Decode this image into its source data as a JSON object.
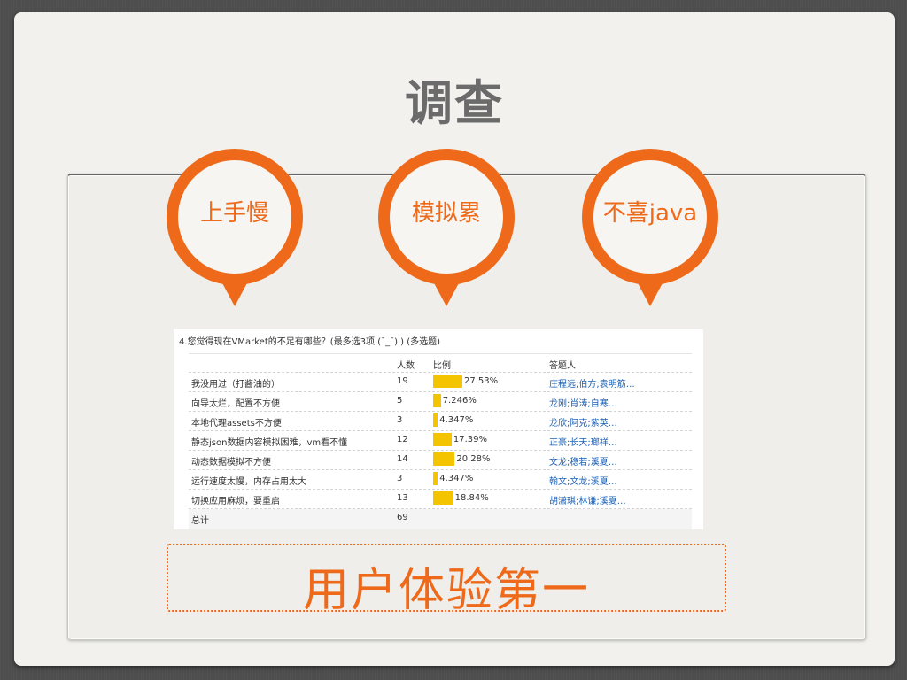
{
  "slide": {
    "title": "调查",
    "bubbles": [
      "上手慢",
      "模拟累",
      "不喜java"
    ],
    "slogan": "用户体验第一"
  },
  "survey": {
    "question": "4.您觉得现在VMarket的不足有哪些？(最多选3项 (¯_¯) ) (多选题)",
    "headers": {
      "option": "",
      "count": "人数",
      "percent": "比例",
      "respondents": "答题人"
    },
    "rows": [
      {
        "option": "我没用过（打酱油的）",
        "count": "19",
        "percent": "27.53%",
        "value": 27.53,
        "respondents": "庄程远;伯方;袁明筋…"
      },
      {
        "option": "向导太烂，配置不方便",
        "count": "5",
        "percent": "7.246%",
        "value": 7.246,
        "respondents": "龙刚;肖涛;自寒…"
      },
      {
        "option": "本地代理assets不方便",
        "count": "3",
        "percent": "4.347%",
        "value": 4.347,
        "respondents": "龙欣;阿克;紫英…"
      },
      {
        "option": "静态json数据内容模拟困难，vm看不懂",
        "count": "12",
        "percent": "17.39%",
        "value": 17.39,
        "respondents": "正豪;长天;瑯祥…"
      },
      {
        "option": "动态数据模拟不方便",
        "count": "14",
        "percent": "20.28%",
        "value": 20.28,
        "respondents": "文龙;稳若;溪夏…"
      },
      {
        "option": "运行速度太慢，内存占用太大",
        "count": "3",
        "percent": "4.347%",
        "value": 4.347,
        "respondents": "翰文;文龙;溪夏…"
      },
      {
        "option": "切换应用麻烦，要重启",
        "count": "13",
        "percent": "18.84%",
        "value": 18.84,
        "respondents": "胡潇琪;林谦;溪夏…"
      }
    ],
    "total": {
      "label": "总计",
      "count": "69"
    }
  },
  "colors": {
    "accent": "#ee6a1a",
    "bar": "#f4c400",
    "title": "#6b6b6b",
    "link": "#1a5fb4"
  }
}
